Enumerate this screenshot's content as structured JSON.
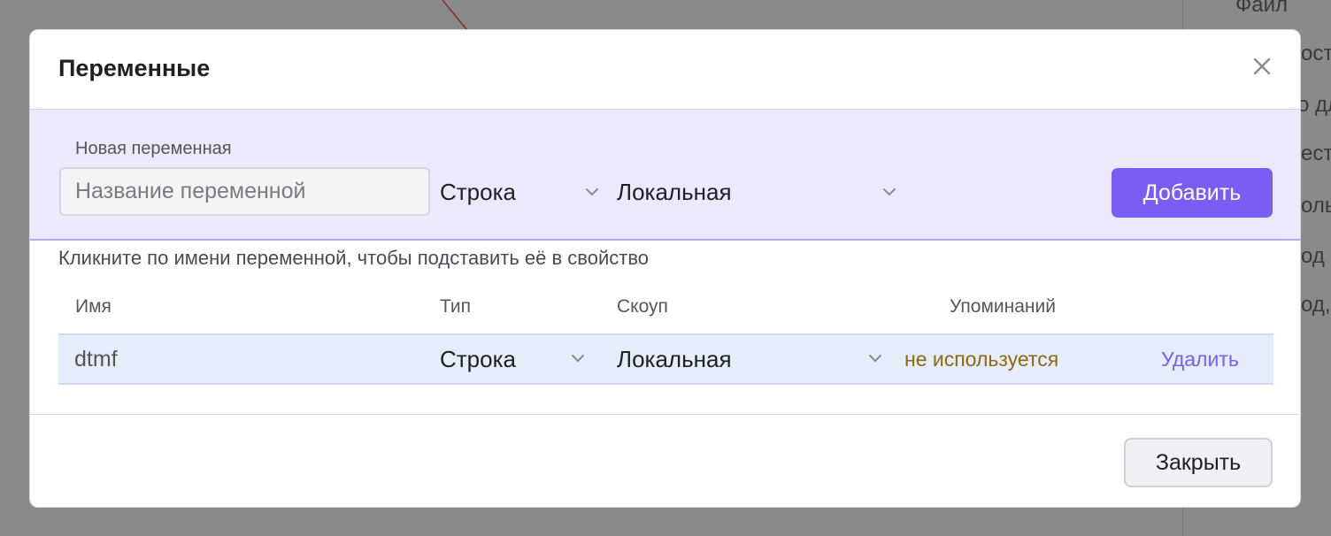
{
  "background": {
    "side_texts": [
      "Файл",
      "ост",
      "о дл",
      "ест",
      "оль",
      "од",
      "од,"
    ]
  },
  "modal": {
    "title": "Переменные",
    "close_icon": "close-icon",
    "new_variable": {
      "label": "Новая переменная",
      "name_placeholder": "Название переменной",
      "type_value": "Строка",
      "scope_value": "Локальная",
      "add_label": "Добавить"
    },
    "hint": "Кликните по имени переменной, чтобы подставить её в свойство",
    "table": {
      "headers": {
        "name": "Имя",
        "type": "Тип",
        "scope": "Скоуп",
        "mentions": "Упоминаний"
      },
      "rows": [
        {
          "name": "dtmf",
          "type": "Строка",
          "scope": "Локальная",
          "mentions": "не используется",
          "delete_label": "Удалить"
        }
      ]
    },
    "footer": {
      "close_label": "Закрыть"
    }
  },
  "colors": {
    "accent": "#7b5cf5",
    "new_variable_bg": "#ece9fd",
    "row_bg": "#e5ecfa",
    "mentions_text": "#8b6a12"
  }
}
